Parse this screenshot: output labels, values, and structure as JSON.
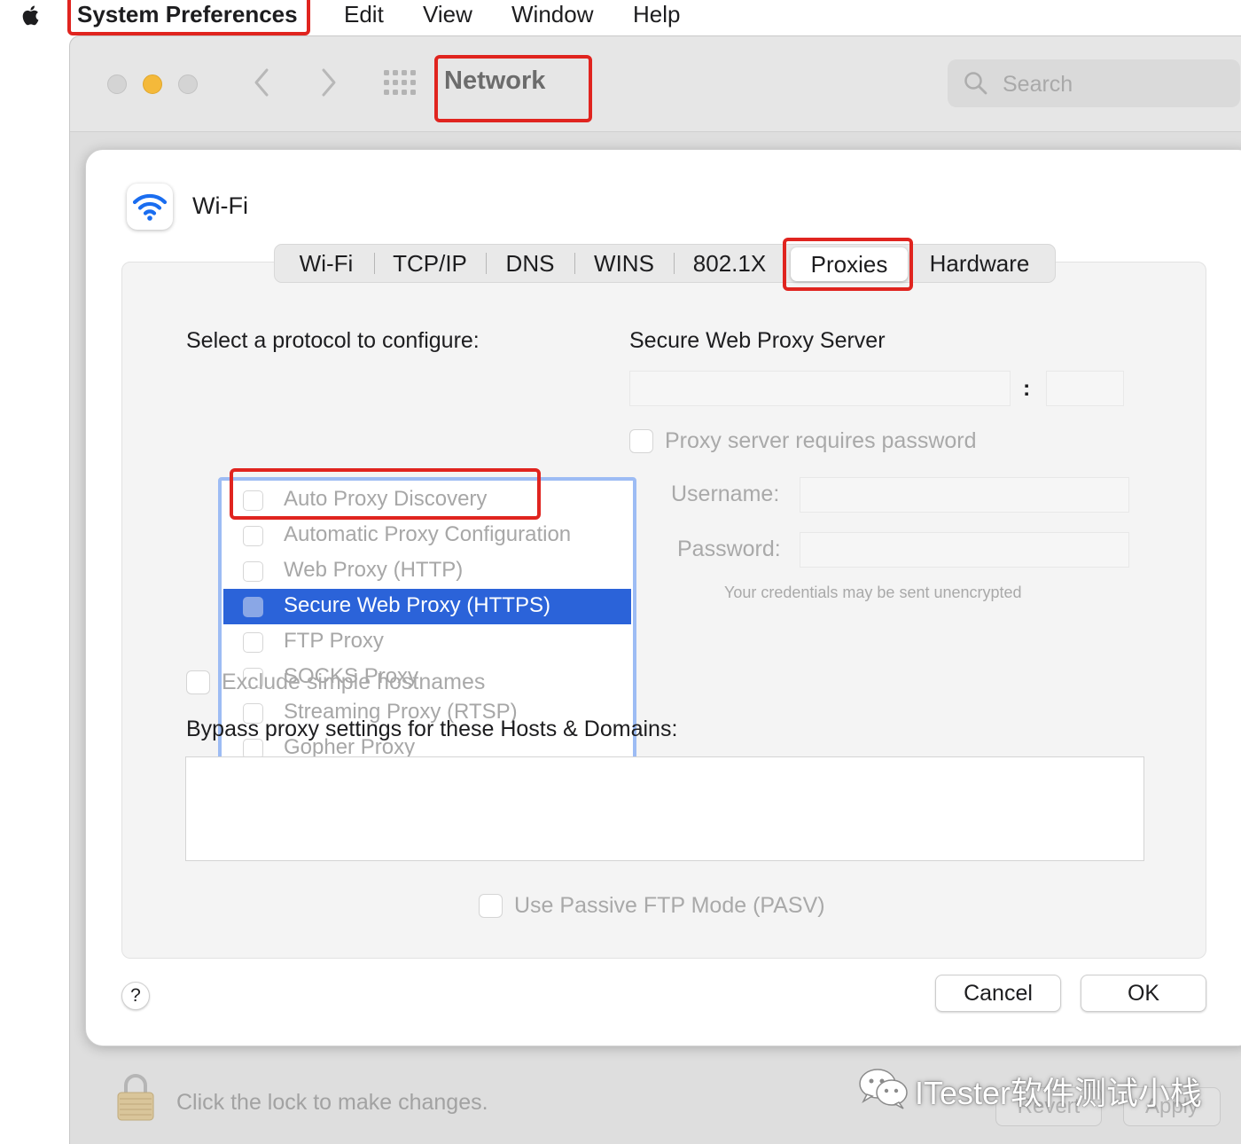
{
  "menubar": {
    "app_name": "System Preferences",
    "items": [
      "Edit",
      "View",
      "Window",
      "Help"
    ]
  },
  "window": {
    "title": "Network",
    "search_placeholder": "Search",
    "lock_text": "Click the lock to make changes.",
    "revert_label": "Revert",
    "apply_label": "Apply"
  },
  "sheet": {
    "interface_name": "Wi-Fi",
    "tabs": [
      "Wi-Fi",
      "TCP/IP",
      "DNS",
      "WINS",
      "802.1X",
      "Proxies",
      "Hardware"
    ],
    "selected_tab": "Proxies",
    "protocol_heading": "Select a protocol to configure:",
    "protocols": [
      {
        "label": "Auto Proxy Discovery",
        "checked": false
      },
      {
        "label": "Automatic Proxy Configuration",
        "checked": false
      },
      {
        "label": "Web Proxy (HTTP)",
        "checked": false
      },
      {
        "label": "Secure Web Proxy (HTTPS)",
        "checked": false,
        "selected": true
      },
      {
        "label": "FTP Proxy",
        "checked": false
      },
      {
        "label": "SOCKS Proxy",
        "checked": false
      },
      {
        "label": "Streaming Proxy (RTSP)",
        "checked": false
      },
      {
        "label": "Gopher Proxy",
        "checked": false
      }
    ],
    "server_heading": "Secure Web Proxy Server",
    "port_separator": ":",
    "server_value": "",
    "port_value": "",
    "requires_password_label": "Proxy server requires password",
    "username_label": "Username:",
    "password_label": "Password:",
    "credentials_note": "Your credentials may be sent unencrypted",
    "exclude_label": "Exclude simple hostnames",
    "bypass_heading": "Bypass proxy settings for these Hosts & Domains:",
    "bypass_value": "",
    "pasv_label": "Use Passive FTP Mode (PASV)",
    "help_label": "?",
    "cancel_label": "Cancel",
    "ok_label": "OK"
  },
  "watermark": {
    "text": "ITester软件测试小栈"
  },
  "colors": {
    "highlight_box": "#e0241f",
    "selection": "#2b63d9",
    "focus_ring": "#9dbcf4",
    "wifi_blue": "#1a6df0"
  }
}
